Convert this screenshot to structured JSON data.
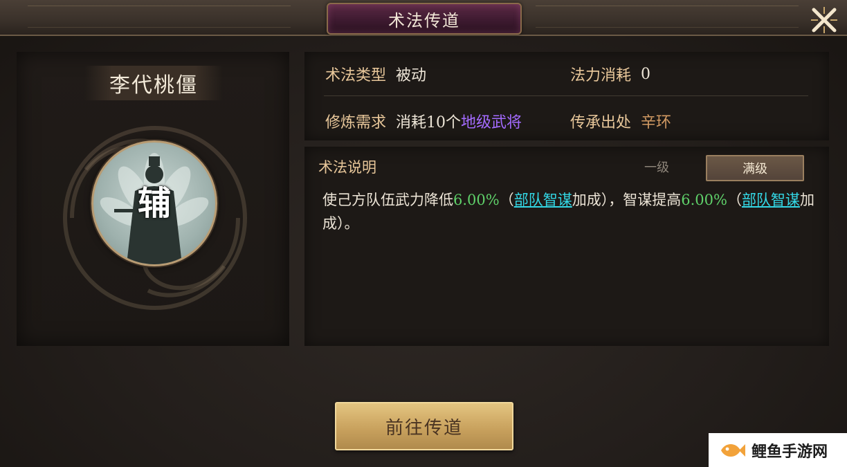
{
  "window": {
    "title": "术法传道"
  },
  "character": {
    "name": "李代桃僵",
    "role_char": "辅"
  },
  "info": {
    "type_label": "术法类型",
    "type_value": "被动",
    "cost_label": "法力消耗",
    "cost_value": "0",
    "req_label": "修炼需求",
    "req_value_prefix": "消耗10个",
    "req_value_highlight": "地级武将",
    "source_label": "传承出处",
    "source_value": "辛环"
  },
  "description": {
    "title": "术法说明",
    "tabs": [
      {
        "label": "一级",
        "active": false
      },
      {
        "label": "满级",
        "active": true
      }
    ],
    "parts": {
      "p1": "使己方队伍武力降低",
      "n1": "6.00%",
      "p2": "（",
      "k1": "部队智谋",
      "p3": "加成），智谋提高",
      "n2": "6.00%",
      "p4": "（",
      "k2": "部队智谋",
      "p5": "加成）。"
    }
  },
  "actions": {
    "go_label": "前往传道"
  },
  "watermark": {
    "text": "鲤鱼手游网"
  },
  "colors": {
    "accent_gold": "#e8c79a",
    "highlight_purple": "#a46bff",
    "number_green": "#5fd16a",
    "keyword_cyan": "#33d8e6",
    "source_tan": "#d29a63"
  },
  "icons": {
    "close": "close-x-icon",
    "watermark_logo": "fish-logo-icon"
  }
}
